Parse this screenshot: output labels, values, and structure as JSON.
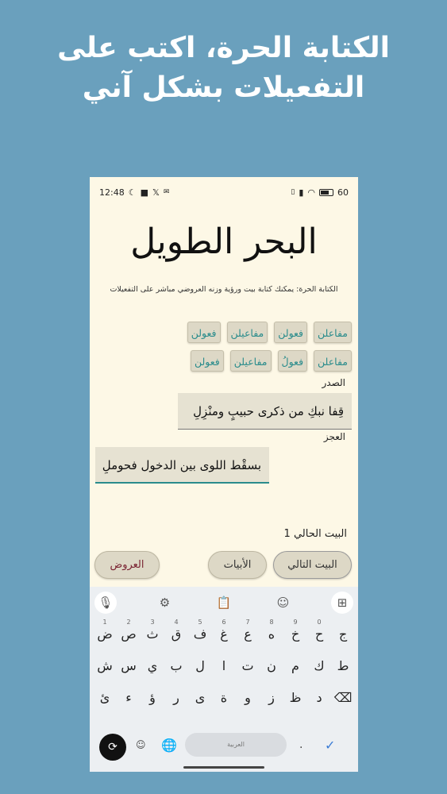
{
  "headline": {
    "line1": "الكتابة الحرة، اكتب على",
    "line2": "التفعيلات بشكل آني"
  },
  "status_bar": {
    "time": "12:48",
    "battery": "60"
  },
  "app": {
    "title": "البحر الطويل",
    "subtitle": "الكتابة الحرة: يمكنك كتابة بيت ورؤية وزنه العروضي مباشر على التفعيلات"
  },
  "tafeelat": {
    "row1": [
      "فعولن",
      "مفاعيلن",
      "فعولن",
      "مفاعلن"
    ],
    "row2": [
      "فعولن",
      "مفاعيلن",
      "فعولُ",
      "مفاعلن"
    ]
  },
  "fields": {
    "sadr_label": "الصدر",
    "sadr_value": "قِفا نبكِ من ذكرى حبيبٍ ومنْزِلِ",
    "ajz_label": "العجز",
    "ajz_value": "بسقْط اللوى بين الدخول فحوملِ"
  },
  "current_verse": "البيت الحالي 1",
  "buttons": {
    "next": "البيت التالي",
    "verses": "الأبيات",
    "prosody": "العروض"
  },
  "keyboard": {
    "toolbar_icons": [
      "mic-icon",
      "gear-icon",
      "clipboard-icon",
      "sticker-icon",
      "grid-icon"
    ],
    "row1": [
      {
        "k": "ج",
        "n": ""
      },
      {
        "k": "ح",
        "n": "0"
      },
      {
        "k": "خ",
        "n": "9"
      },
      {
        "k": "ه",
        "n": "8"
      },
      {
        "k": "ع",
        "n": "7"
      },
      {
        "k": "غ",
        "n": "6"
      },
      {
        "k": "ف",
        "n": "5"
      },
      {
        "k": "ق",
        "n": "4"
      },
      {
        "k": "ث",
        "n": "3"
      },
      {
        "k": "ص",
        "n": "2"
      },
      {
        "k": "ض",
        "n": "1"
      }
    ],
    "row2": [
      "ط",
      "ك",
      "م",
      "ن",
      "ت",
      "ا",
      "ل",
      "ب",
      "ي",
      "س",
      "ش"
    ],
    "row3": [
      "⌫",
      "د",
      "ظ",
      "ز",
      "و",
      "ة",
      "ى",
      "ر",
      "ؤ",
      "ء",
      "ئ"
    ],
    "space_label": "العربية",
    "emoji": "☺",
    "globe": "🌐",
    "dot": ".",
    "enter": "✓",
    "rotate": "⟳"
  },
  "colors": {
    "page_bg": "#6aa0bd",
    "app_bg": "#fdf8e6",
    "chip_text": "#2a8c8c",
    "prosody_text": "#7a2332"
  }
}
